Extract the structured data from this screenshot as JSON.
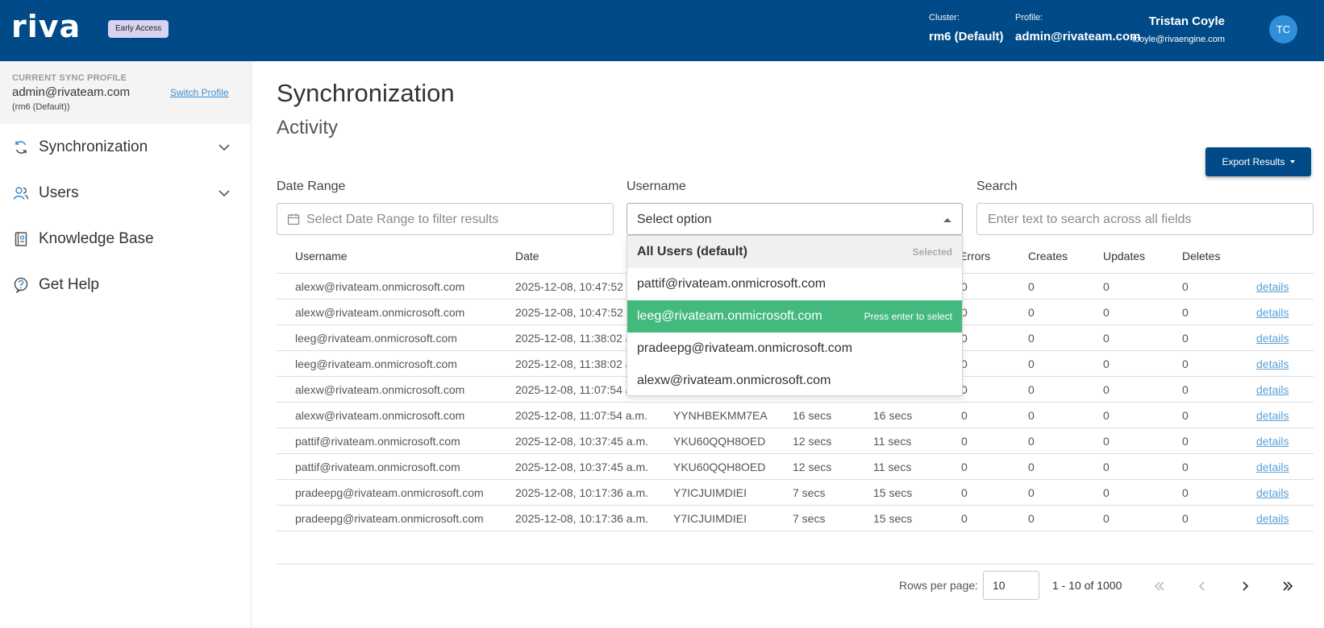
{
  "header": {
    "brand": "riva",
    "badge": "Early Access",
    "cluster_label": "Cluster:",
    "cluster_value": "rm6 (Default)",
    "profile_label": "Profile:",
    "profile_value": "admin@rivateam.com",
    "user_name": "Tristan Coyle",
    "user_email": "tcoyle@rivaengine.com",
    "avatar_initials": "TC"
  },
  "sidebar": {
    "current_profile_label": "CURRENT SYNC PROFILE",
    "profile_email": "admin@rivateam.com",
    "profile_cluster": "(rm6 (Default))",
    "switch_link": "Switch Profile",
    "items": [
      {
        "label": "Synchronization",
        "icon": "sync-icon",
        "expandable": true
      },
      {
        "label": "Users",
        "icon": "users-icon",
        "expandable": true
      },
      {
        "label": "Knowledge Base",
        "icon": "book-icon",
        "expandable": false
      },
      {
        "label": "Get Help",
        "icon": "help-icon",
        "expandable": false
      }
    ]
  },
  "main": {
    "title": "Synchronization",
    "subtitle": "Activity",
    "export_button": "Export Results",
    "filters": {
      "date_range_label": "Date Range",
      "date_range_placeholder": "Select Date Range to filter results",
      "username_label": "Username",
      "username_value": "Select option",
      "search_label": "Search",
      "search_placeholder": "Enter text to search across all fields"
    },
    "username_dropdown": {
      "options": [
        {
          "label": "All Users (default)",
          "state": "selected",
          "hint": "Selected"
        },
        {
          "label": "pattif@rivateam.onmicrosoft.com",
          "state": "",
          "hint": ""
        },
        {
          "label": "leeg@rivateam.onmicrosoft.com",
          "state": "highlighted",
          "hint": "Press enter to select"
        },
        {
          "label": "pradeepg@rivateam.onmicrosoft.com",
          "state": "",
          "hint": ""
        },
        {
          "label": "alexw@rivateam.onmicrosoft.com",
          "state": "",
          "hint": ""
        }
      ]
    },
    "table": {
      "columns": [
        "Username",
        "Date",
        "",
        "",
        "",
        "Errors",
        "Creates",
        "Updates",
        "Deletes",
        ""
      ],
      "rows": [
        [
          "alexw@rivateam.onmicrosoft.com",
          "2025-12-08, 10:47:52 a.m.",
          "",
          "",
          "",
          "0",
          "0",
          "0",
          "0",
          "details"
        ],
        [
          "alexw@rivateam.onmicrosoft.com",
          "2025-12-08, 10:47:52 a.m.",
          "",
          "",
          "",
          "0",
          "0",
          "0",
          "0",
          "details"
        ],
        [
          "leeg@rivateam.onmicrosoft.com",
          "2025-12-08, 11:38:02 a.m.",
          "",
          "",
          "",
          "0",
          "0",
          "0",
          "0",
          "details"
        ],
        [
          "leeg@rivateam.onmicrosoft.com",
          "2025-12-08, 11:38:02 a.m.",
          "",
          "",
          "",
          "0",
          "0",
          "0",
          "0",
          "details"
        ],
        [
          "alexw@rivateam.onmicrosoft.com",
          "2025-12-08, 11:07:54 a.m.",
          "",
          "",
          "",
          "0",
          "0",
          "0",
          "0",
          "details"
        ],
        [
          "alexw@rivateam.onmicrosoft.com",
          "2025-12-08, 11:07:54 a.m.",
          "YYNHBEKMM7EA",
          "16 secs",
          "16 secs",
          "0",
          "0",
          "0",
          "0",
          "details"
        ],
        [
          "pattif@rivateam.onmicrosoft.com",
          "2025-12-08, 10:37:45 a.m.",
          "YKU60QQH8OED",
          "12 secs",
          "11 secs",
          "0",
          "0",
          "0",
          "0",
          "details"
        ],
        [
          "pattif@rivateam.onmicrosoft.com",
          "2025-12-08, 10:37:45 a.m.",
          "YKU60QQH8OED",
          "12 secs",
          "11 secs",
          "0",
          "0",
          "0",
          "0",
          "details"
        ],
        [
          "pradeepg@rivateam.onmicrosoft.com",
          "2025-12-08, 10:17:36 a.m.",
          "Y7ICJUIMDIEI",
          "7 secs",
          "15 secs",
          "0",
          "0",
          "0",
          "0",
          "details"
        ],
        [
          "pradeepg@rivateam.onmicrosoft.com",
          "2025-12-08, 10:17:36 a.m.",
          "Y7ICJUIMDIEI",
          "7 secs",
          "15 secs",
          "0",
          "0",
          "0",
          "0",
          "details"
        ]
      ]
    },
    "pagination": {
      "rows_per_page_label": "Rows per page:",
      "rows_per_page_value": "10",
      "range": "1 - 10 of 1000"
    }
  },
  "colors": {
    "header_bg": "#004b87",
    "accent_green": "#43b97e",
    "link_blue": "#5aa0d6"
  }
}
